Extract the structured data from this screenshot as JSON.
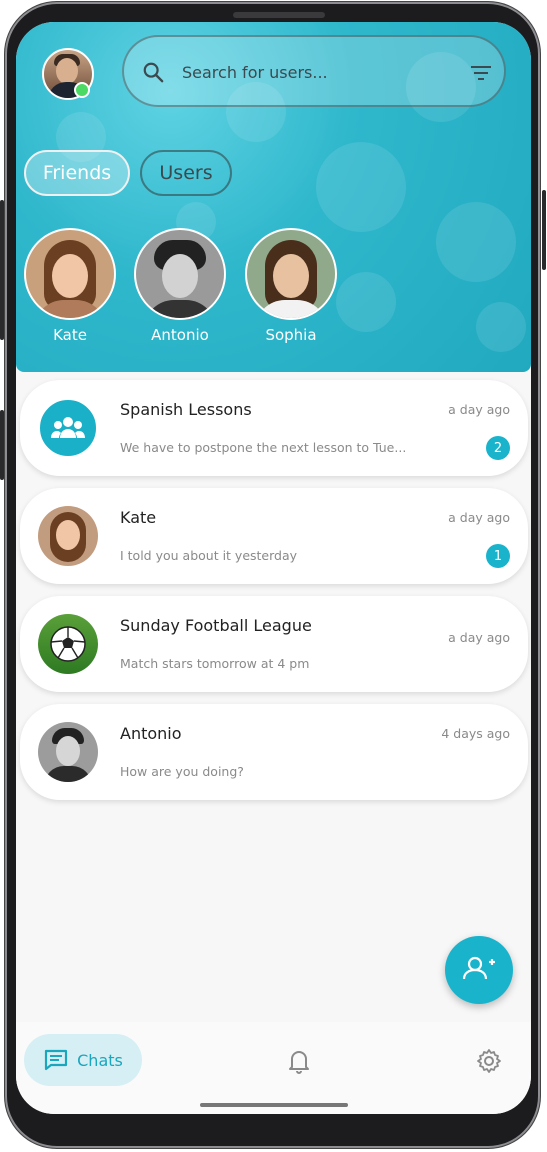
{
  "header": {
    "search_placeholder": "Search for users...",
    "tabs": [
      {
        "label": "Friends",
        "active": true
      },
      {
        "label": "Users",
        "active": false
      }
    ],
    "friends": [
      {
        "name": "Kate"
      },
      {
        "name": "Antonio"
      },
      {
        "name": "Sophia"
      }
    ]
  },
  "chats": [
    {
      "title": "Spanish Lessons",
      "message": "We have to postpone the next lesson to Tue...",
      "time": "a day ago",
      "unread": "2",
      "avatar": "group-icon"
    },
    {
      "title": "Kate",
      "message": "I told you about it yesterday",
      "time": "a day ago",
      "unread": "1",
      "avatar": "kate-photo"
    },
    {
      "title": "Sunday Football League",
      "message": "Match stars tomorrow at 4 pm",
      "time": "a day ago",
      "unread": "",
      "avatar": "soccer-ball-photo"
    },
    {
      "title": "Antonio",
      "message": "How are you doing?",
      "time": "4 days ago",
      "unread": "",
      "avatar": "antonio-photo"
    }
  ],
  "nav": {
    "chats_label": "Chats",
    "items": [
      "chats-icon",
      "bell-icon",
      "gear-icon"
    ]
  },
  "colors": {
    "accent": "#19b3cc",
    "header_bg": "#2fb7cc",
    "nav_active_bg": "#d6eff4"
  },
  "fab_icon": "add-user-icon"
}
